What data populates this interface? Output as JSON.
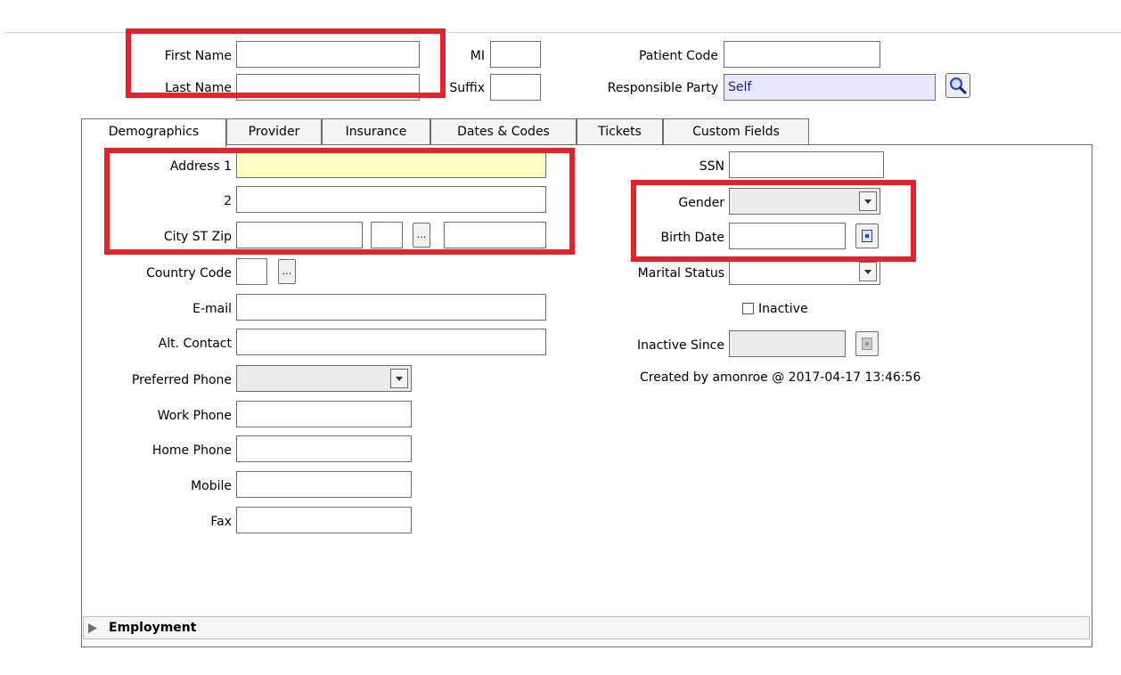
{
  "header": {
    "first_name_label": "First Name",
    "last_name_label": "Last Name",
    "mi_label": "MI",
    "suffix_label": "Suffix",
    "patient_code_label": "Patient Code",
    "responsible_party_label": "Responsible Party",
    "responsible_party_value": "Self"
  },
  "tabs": [
    {
      "label": "Demographics"
    },
    {
      "label": "Provider"
    },
    {
      "label": "Insurance"
    },
    {
      "label": "Dates & Codes"
    },
    {
      "label": "Tickets"
    },
    {
      "label": "Custom Fields"
    }
  ],
  "left": {
    "address1_label": "Address 1",
    "address2_label": "2",
    "city_label": "City ST Zip",
    "country_label": "Country Code",
    "email_label": "E-mail",
    "alt_contact_label": "Alt. Contact",
    "preferred_phone_label": "Preferred Phone",
    "work_phone_label": "Work Phone",
    "home_phone_label": "Home Phone",
    "mobile_label": "Mobile",
    "fax_label": "Fax",
    "dots": "..."
  },
  "right": {
    "ssn_label": "SSN",
    "gender_label": "Gender",
    "birth_date_label": "Birth Date",
    "marital_label": "Marital Status",
    "inactive_label": "Inactive",
    "inactive_since_label": "Inactive Since",
    "created_by": "Created by amonroe @ 2017-04-17 13:46:56"
  },
  "employment": {
    "label": "Employment"
  },
  "colors": {
    "highlight_box": "#e8202a",
    "address_field": "#ffffc4",
    "responsible_field": "#e7e7ff"
  }
}
